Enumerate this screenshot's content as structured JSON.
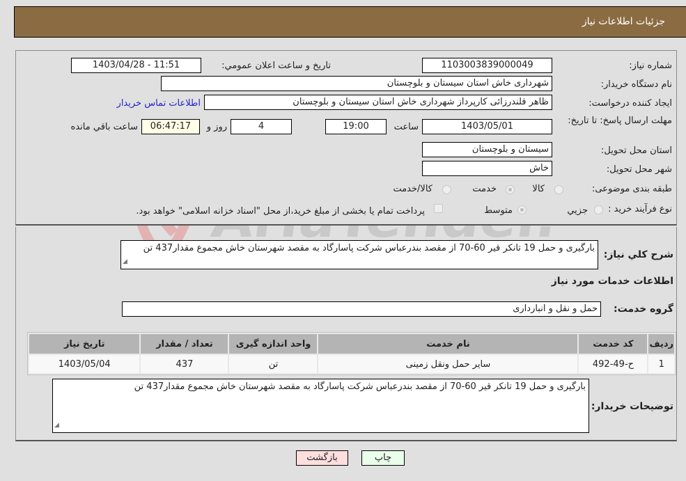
{
  "header": {
    "title": "جزئيات اطلاعات نياز"
  },
  "fields": {
    "need_number": {
      "label": "شماره نیاز:",
      "value": "1103003839000049"
    },
    "announce_datetime": {
      "label": "تاريخ و ساعت اعلان عمومي:",
      "value": "1403/04/28 - 11:51"
    },
    "buyer_org": {
      "label": "نام دستگاه خريدار:",
      "value": "شهرداری خاش استان سیستان و بلوچستان"
    },
    "requester": {
      "label": "ايجاد کننده درخواست:",
      "value": "ظاهر قلندرزائی کارپرداز شهرداری خاش استان سیستان و بلوچستان"
    },
    "buyer_contact_link": "اطلاعات تماس خريدار",
    "deadline": {
      "label": "مهلت ارسال پاسخ: تا تاريخ:",
      "date": "1403/05/01",
      "time_label": "ساعت",
      "time": "19:00",
      "days": "4",
      "days_label": "روز و",
      "remaining": "06:47:17",
      "remaining_label": "ساعت باقي مانده"
    },
    "delivery_province": {
      "label": "استان محل تحويل:",
      "value": "سیستان و بلوچستان"
    },
    "delivery_city": {
      "label": "شهر محل تحويل:",
      "value": "خاش"
    },
    "category": {
      "label": "طبقه بندی موضوعی:",
      "options": [
        "کالا",
        "خدمت",
        "کالا/خدمت"
      ],
      "selected": "خدمت"
    },
    "purchase_type": {
      "label": "نوع فرآيند خريد :",
      "options": [
        "جزيي",
        "متوسط"
      ],
      "selected": "متوسط",
      "treasury_checkbox_label": "پرداخت تمام يا بخشی از مبلغ خريد،از محل \"اسناد خزانه اسلامی\" خواهد بود.",
      "treasury_checked": false
    }
  },
  "general_description": {
    "label": "شرح کلي نياز:",
    "value": "بارگیری و حمل 19 تانکر قیر 60-70 از مقصد بندرعباس شرکت پاسارگاد به مقصد شهرستان خاش مجموع مقدار437 تن"
  },
  "services_section": {
    "title": "اطلاعات خدمات مورد نياز",
    "service_group_label": "گروه خدمت:",
    "service_group_value": "حمل و نقل و انبارداری"
  },
  "services_table": {
    "headers": [
      "رديف",
      "کد خدمت",
      "نام خدمت",
      "واحد اندازه گيری",
      "تعداد / مقدار",
      "تاريخ نياز"
    ],
    "rows": [
      [
        "1",
        "ح-49-492",
        "سایر حمل ونقل زمینی",
        "تن",
        "437",
        "1403/05/04"
      ]
    ]
  },
  "buyer_notes": {
    "label": "توضيحات خريدار:",
    "value": "بارگیری و حمل 19 تانکر قیر 60-70 از مقصد بندرعباس شرکت پاسارگاد به مقصد شهرستان خاش مجموع مقدار437 تن"
  },
  "buttons": {
    "print": "چاپ",
    "back": "بازگشت"
  },
  "watermark": {
    "text": "AriaTender.neT"
  },
  "colors": {
    "header_bg": "#8b6c42",
    "link": "#2222cc",
    "print_bg": "#eaffea",
    "back_bg": "#ffdede"
  }
}
